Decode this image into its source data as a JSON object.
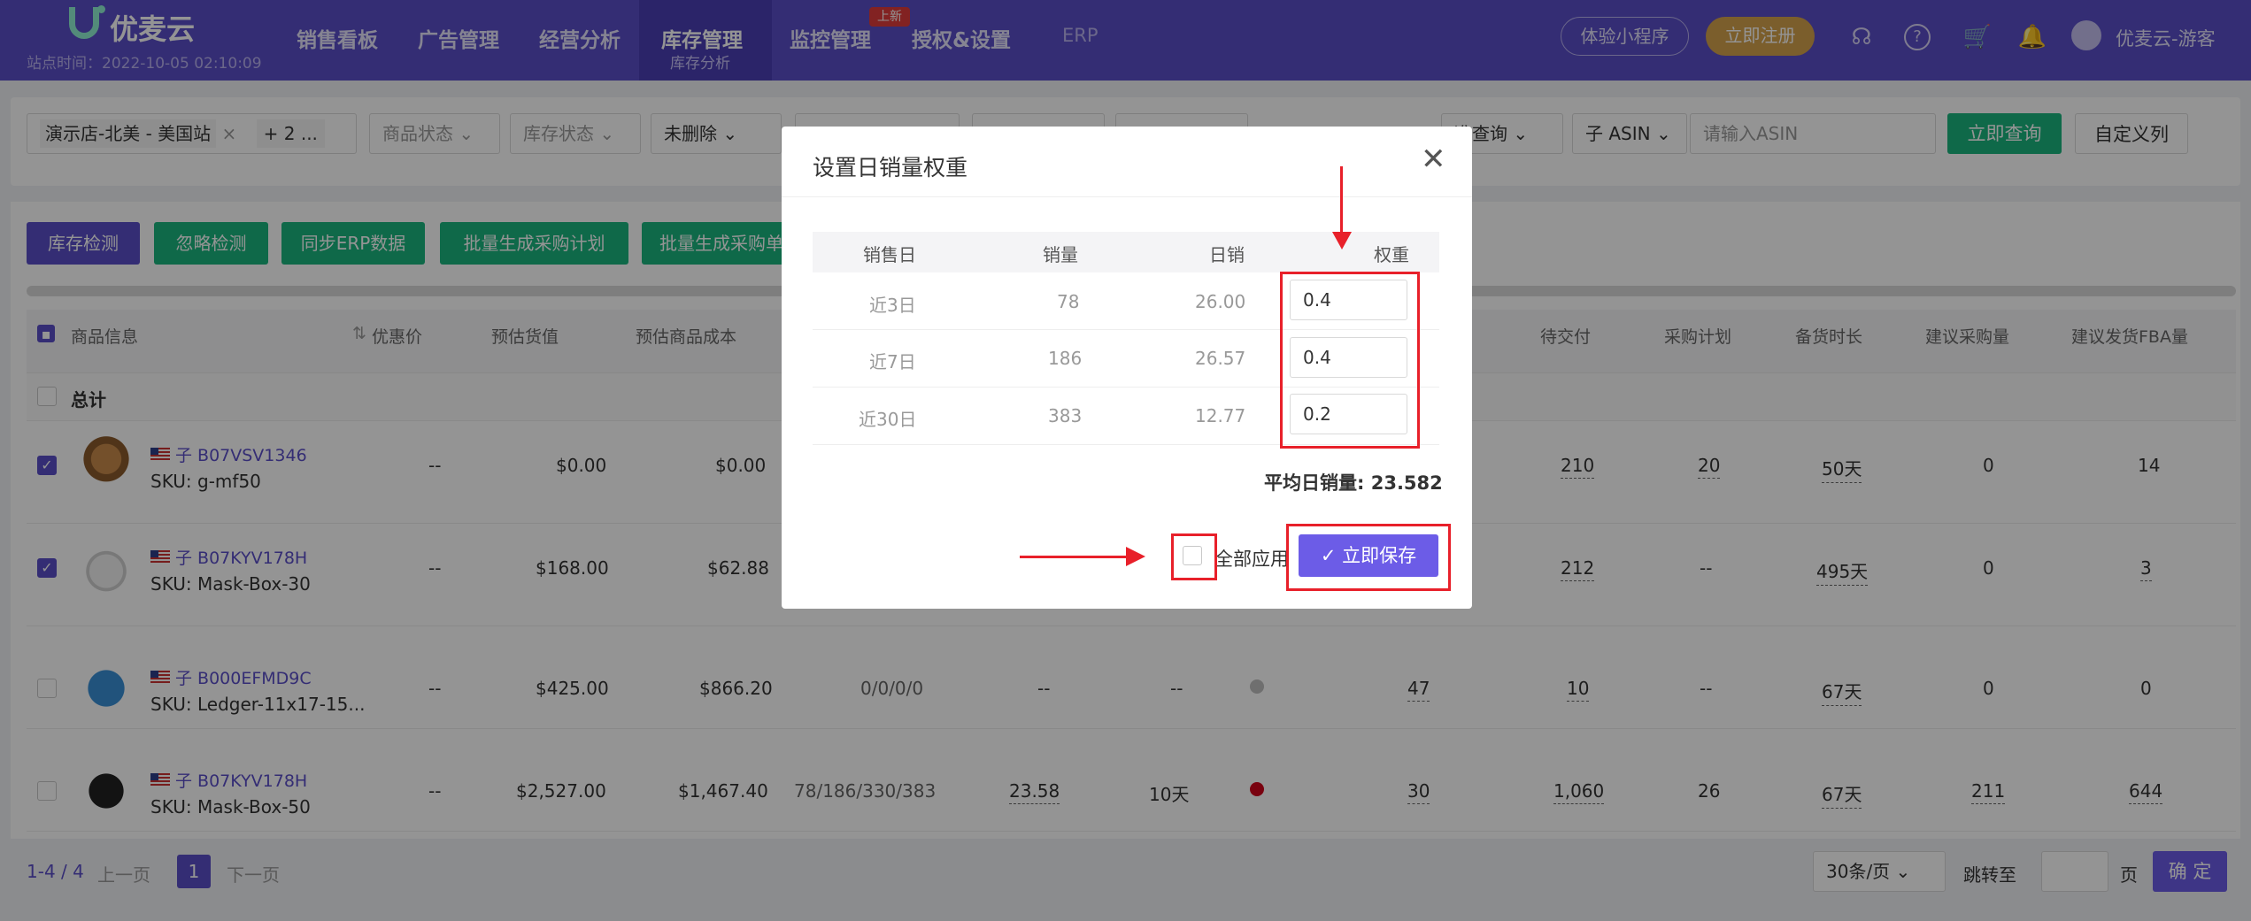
{
  "header": {
    "logo": "优麦云",
    "site_time": "站点时间：2022-10-05 02:10:09",
    "nav": [
      "销售看板",
      "广告管理",
      "经营分析",
      "库存管理",
      "监控管理",
      "授权&设置",
      "ERP"
    ],
    "active_sub": "库存分析",
    "new_badge": "上新",
    "mini_program": "体验小程序",
    "register": "立即注册",
    "username": "优麦云-游客",
    "icons": [
      "headset-icon",
      "help-icon",
      "cart-icon",
      "bell-icon",
      "user-avatar-icon"
    ],
    "colors": {
      "nav_bg": "#5b4ec8",
      "accent": "#6c5ce7",
      "register_bg": "#d4a24c"
    }
  },
  "filters": {
    "store": "演示店-北美 - 美国站",
    "store_more": "+ 2 ...",
    "product_status": "商品状态",
    "stock_status": "库存状态",
    "delete_status": "未删除",
    "precise_query": "准查询",
    "asin_type": "子 ASIN",
    "asin_placeholder": "请输入ASIN",
    "query_btn": "立即查询",
    "custom_cols_btn": "自定义列"
  },
  "actions": [
    "库存检测",
    "忽略检测",
    "同步ERP数据",
    "批量生成采购计划",
    "批量生成采购单"
  ],
  "table": {
    "headers": [
      "商品信息",
      "优惠价",
      "预估货值",
      "预估商品成本",
      "待交付",
      "采购计划",
      "备货时长",
      "建议采购量",
      "建议发货FBA量"
    ],
    "total_label": "总计",
    "rows": [
      {
        "checked": true,
        "asin": "子 B07VSV1346",
        "sku": "SKU: g-mf50",
        "discount": "--",
        "est_value": "$0.00",
        "est_cost": "$0.00",
        "pending": "210",
        "plan": "20",
        "lead": "50天",
        "suggest_buy": "0",
        "suggest_fba": "14"
      },
      {
        "checked": true,
        "asin": "子 B07KYV178H",
        "sku": "SKU: Mask-Box-30",
        "discount": "--",
        "est_value": "$168.00",
        "est_cost": "$62.88",
        "pending": "212",
        "plan": "--",
        "lead": "495天",
        "suggest_buy": "0",
        "suggest_fba": "3"
      },
      {
        "checked": false,
        "asin": "子 B000EFMD9C",
        "sku": "SKU: Ledger-11x17-15...",
        "discount": "--",
        "est_value": "$425.00",
        "est_cost": "$866.20",
        "sales": "0/0/0/0",
        "daily": "--",
        "days": "--",
        "status_color": "#c0c0c0",
        "stock": "47",
        "pending": "10",
        "plan": "--",
        "lead": "67天",
        "suggest_buy": "0",
        "suggest_fba": "0"
      },
      {
        "checked": false,
        "asin": "子 B07KYV178H",
        "sku": "SKU: Mask-Box-50",
        "discount": "--",
        "est_value": "$2,527.00",
        "est_cost": "$1,467.40",
        "sales": "78/186/330/383",
        "daily": "23.58",
        "days": "10天",
        "status_color": "#d0021b",
        "stock": "30",
        "pending": "1,060",
        "plan": "26",
        "lead": "67天",
        "suggest_buy": "211",
        "suggest_fba": "644"
      }
    ]
  },
  "pager": {
    "range": "1-4 / 4",
    "prev": "上一页",
    "page": "1",
    "next": "下一页",
    "page_size": "30条/页",
    "goto": "跳转至",
    "page_unit": "页",
    "confirm": "确 定"
  },
  "modal": {
    "title": "设置日销量权重",
    "headers": [
      "销售日",
      "销量",
      "日销",
      "权重"
    ],
    "rows": [
      {
        "period": "近3日",
        "sales": "78",
        "daily": "26.00",
        "weight": "0.4"
      },
      {
        "period": "近7日",
        "sales": "186",
        "daily": "26.57",
        "weight": "0.4"
      },
      {
        "period": "近30日",
        "sales": "383",
        "daily": "12.77",
        "weight": "0.2"
      }
    ],
    "avg_label": "平均日销量:",
    "avg_value": "23.582",
    "apply_all": "全部应用",
    "save": "立即保存"
  }
}
